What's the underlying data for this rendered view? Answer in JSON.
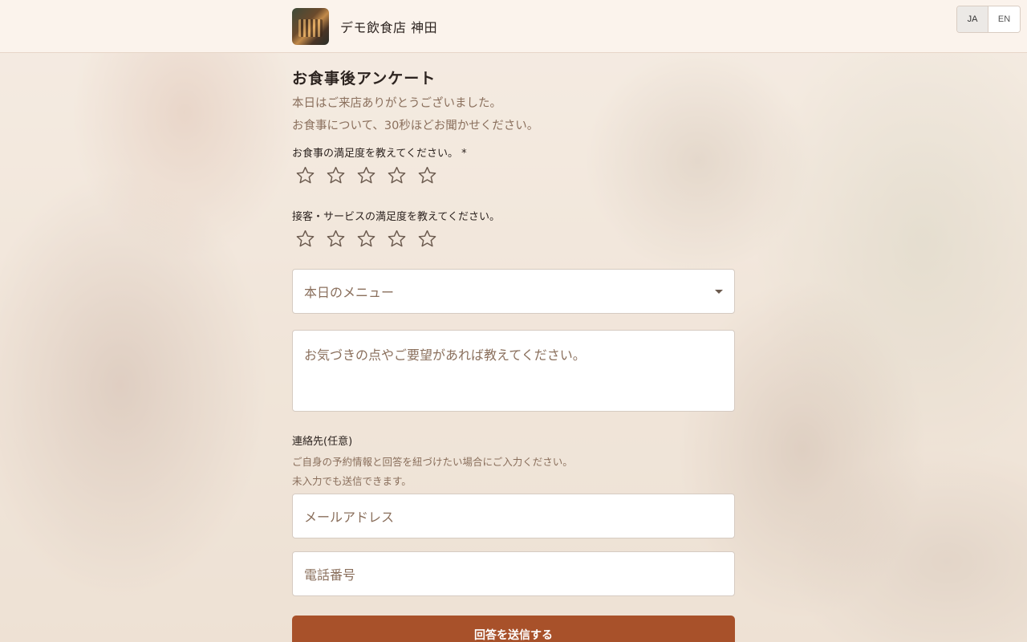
{
  "header": {
    "restaurant_name": "デモ飲食店 神田",
    "logo_icon": "restaurant-photo-icon",
    "languages": [
      {
        "code": "JA",
        "active": true
      },
      {
        "code": "EN",
        "active": false
      }
    ]
  },
  "survey": {
    "title": "お食事後アンケート",
    "intro_line1": "本日はご来店ありがとうございました。",
    "intro_line2": "お食事について、30秒ほどお聞かせください。",
    "q_food_label": "お食事の満足度を教えてください。 *",
    "q_service_label": "接客・サービスの満足度を教えてください。",
    "star_count": 5,
    "food_rating": 0,
    "service_rating": 0,
    "menu_select_placeholder": "本日のメニュー",
    "comment_placeholder": "お気づきの点やご要望があれば教えてください。",
    "contact_title": "連絡先(任意)",
    "contact_note1": "ご自身の予約情報と回答を紐づけたい場合にご入力ください。",
    "contact_note2": "未入力でも送信できます。",
    "email_placeholder": "メールアドレス",
    "phone_placeholder": "電話番号",
    "submit_label": "回答を送信する"
  },
  "colors": {
    "accent": "#a8512a",
    "muted_text": "#8a6f5c",
    "header_bg": "#fbf3ec"
  }
}
